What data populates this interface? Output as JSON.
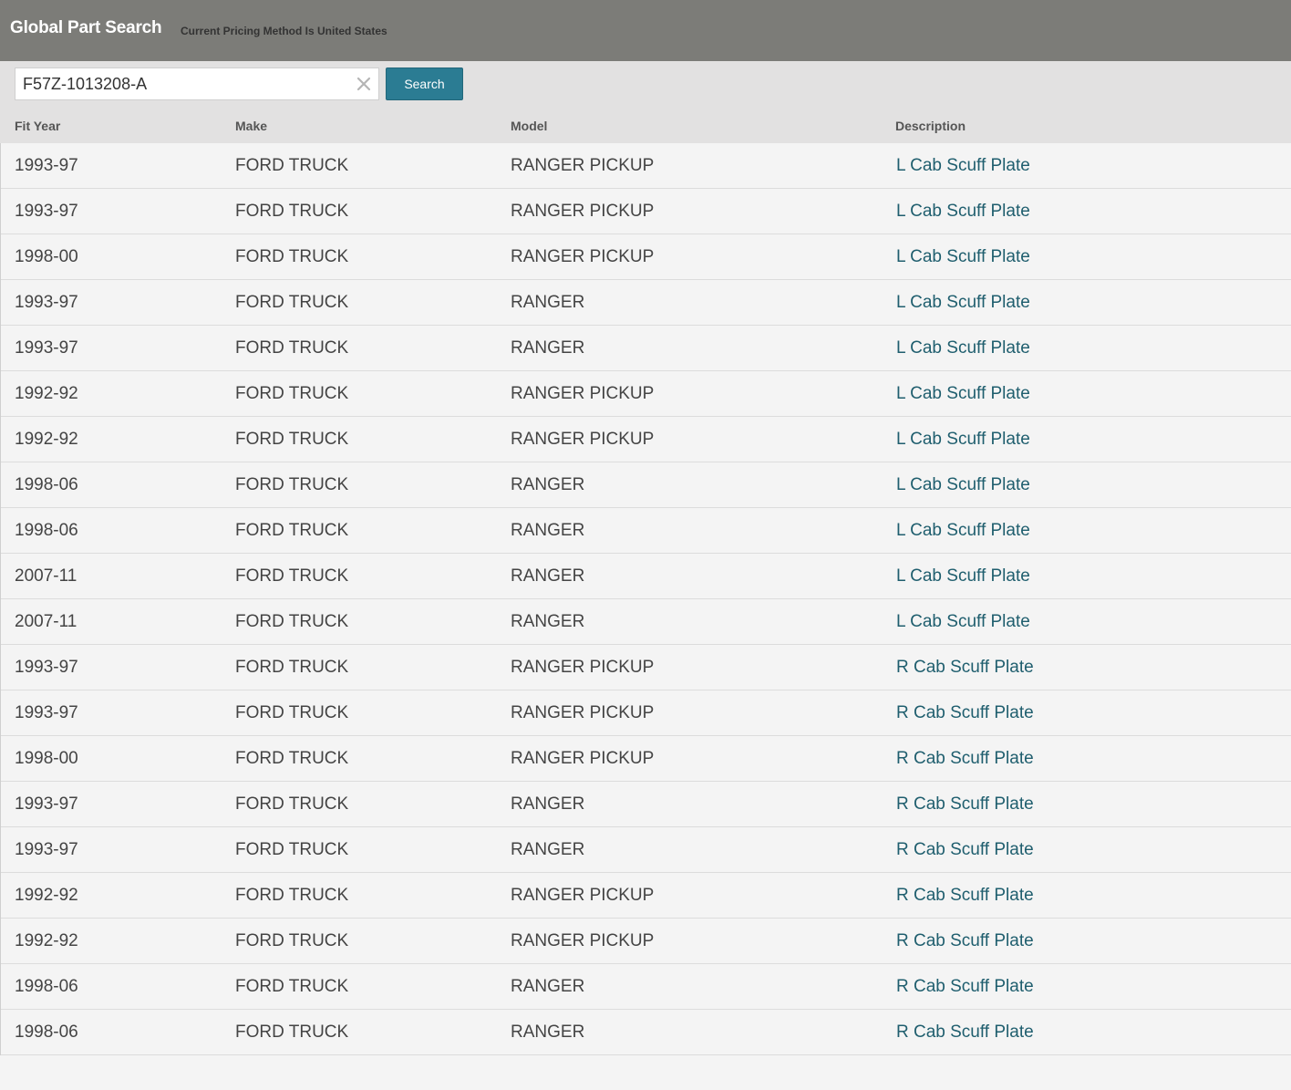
{
  "header": {
    "title": "Global Part Search",
    "subtitle": "Current Pricing Method Is United States"
  },
  "search": {
    "value": "F57Z-1013208-A",
    "button_label": "Search",
    "clear_icon": "close-icon"
  },
  "table": {
    "columns": [
      "Fit Year",
      "Make",
      "Model",
      "Description"
    ],
    "rows": [
      [
        "1993-97",
        "FORD TRUCK",
        "RANGER PICKUP",
        "L Cab Scuff Plate"
      ],
      [
        "1993-97",
        "FORD TRUCK",
        "RANGER PICKUP",
        "L Cab Scuff Plate"
      ],
      [
        "1998-00",
        "FORD TRUCK",
        "RANGER PICKUP",
        "L Cab Scuff Plate"
      ],
      [
        "1993-97",
        "FORD TRUCK",
        "RANGER",
        "L Cab Scuff Plate"
      ],
      [
        "1993-97",
        "FORD TRUCK",
        "RANGER",
        "L Cab Scuff Plate"
      ],
      [
        "1992-92",
        "FORD TRUCK",
        "RANGER PICKUP",
        "L Cab Scuff Plate"
      ],
      [
        "1992-92",
        "FORD TRUCK",
        "RANGER PICKUP",
        "L Cab Scuff Plate"
      ],
      [
        "1998-06",
        "FORD TRUCK",
        "RANGER",
        "L Cab Scuff Plate"
      ],
      [
        "1998-06",
        "FORD TRUCK",
        "RANGER",
        "L Cab Scuff Plate"
      ],
      [
        "2007-11",
        "FORD TRUCK",
        "RANGER",
        "L Cab Scuff Plate"
      ],
      [
        "2007-11",
        "FORD TRUCK",
        "RANGER",
        "L Cab Scuff Plate"
      ],
      [
        "1993-97",
        "FORD TRUCK",
        "RANGER PICKUP",
        "R Cab Scuff Plate"
      ],
      [
        "1993-97",
        "FORD TRUCK",
        "RANGER PICKUP",
        "R Cab Scuff Plate"
      ],
      [
        "1998-00",
        "FORD TRUCK",
        "RANGER PICKUP",
        "R Cab Scuff Plate"
      ],
      [
        "1993-97",
        "FORD TRUCK",
        "RANGER",
        "R Cab Scuff Plate"
      ],
      [
        "1993-97",
        "FORD TRUCK",
        "RANGER",
        "R Cab Scuff Plate"
      ],
      [
        "1992-92",
        "FORD TRUCK",
        "RANGER PICKUP",
        "R Cab Scuff Plate"
      ],
      [
        "1992-92",
        "FORD TRUCK",
        "RANGER PICKUP",
        "R Cab Scuff Plate"
      ],
      [
        "1998-06",
        "FORD TRUCK",
        "RANGER",
        "R Cab Scuff Plate"
      ],
      [
        "1998-06",
        "FORD TRUCK",
        "RANGER",
        "R Cab Scuff Plate"
      ]
    ]
  },
  "colors": {
    "header_bg": "#7c7c78",
    "toolbar_bg": "#e2e1e1",
    "button_bg": "#2b7c93",
    "link": "#1f5e6e"
  }
}
